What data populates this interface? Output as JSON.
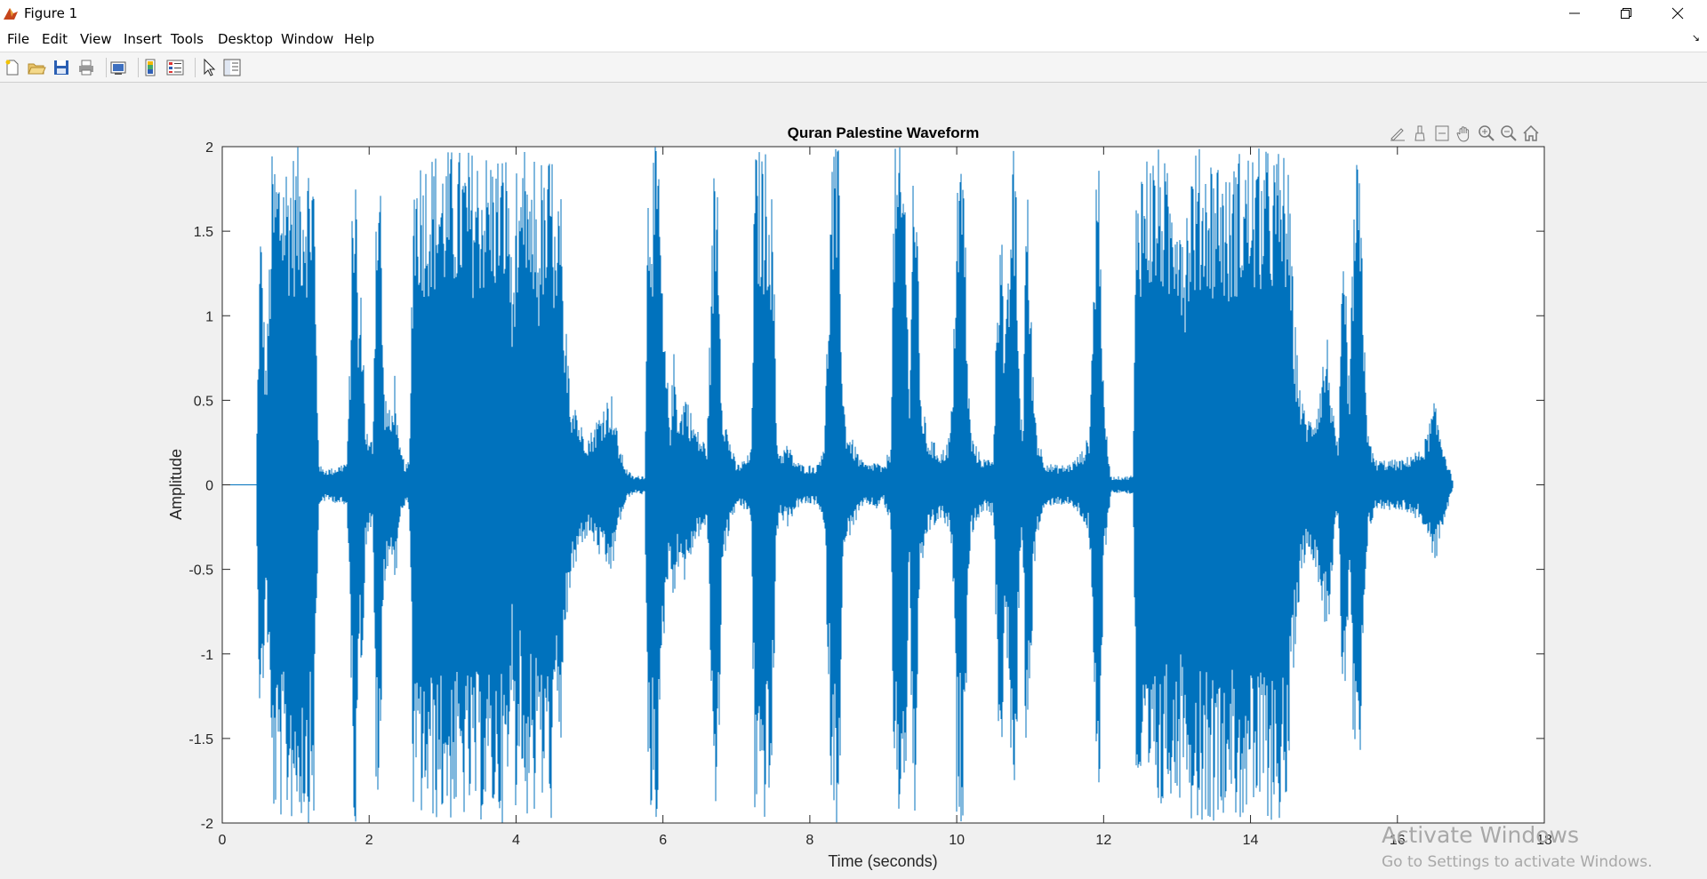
{
  "window": {
    "title": "Figure 1",
    "controls": {
      "minimize": "minimize-icon",
      "restore": "restore-icon",
      "close": "close-icon"
    }
  },
  "menu": {
    "items": [
      {
        "label": "File"
      },
      {
        "label": "Edit"
      },
      {
        "label": "View"
      },
      {
        "label": "Insert"
      },
      {
        "label": "Tools"
      },
      {
        "label": "Desktop"
      },
      {
        "label": "Window"
      },
      {
        "label": "Help"
      }
    ],
    "corner": "↘"
  },
  "toolbar": {
    "buttons": [
      "new-figure-icon",
      "open-file-icon",
      "save-icon",
      "print-icon",
      "link-plot-icon",
      "colorbar-icon",
      "legend-icon",
      "edit-plot-icon",
      "property-inspector-icon"
    ]
  },
  "axes_toolbar": {
    "buttons": [
      "brush-edit-icon",
      "brush-icon",
      "data-tips-icon",
      "pan-icon",
      "zoom-in-icon",
      "zoom-out-icon",
      "home-icon"
    ]
  },
  "watermark": {
    "line1": "Activate Windows",
    "line2": "Go to Settings to activate Windows."
  },
  "colors": {
    "series": "#0072BD",
    "axes": "#262626",
    "background": "#f0f0f0"
  },
  "chart_data": {
    "type": "line",
    "title": "Quran Palestine Waveform",
    "xlabel": "Time (seconds)",
    "ylabel": "Amplitude",
    "xlim": [
      0,
      18
    ],
    "ylim": [
      -2,
      2
    ],
    "xticks": [
      0,
      2,
      4,
      6,
      8,
      10,
      12,
      14,
      16,
      18
    ],
    "yticks": [
      -2,
      -1.5,
      -1,
      -0.5,
      0,
      0.5,
      1,
      1.5,
      2
    ],
    "ytick_labels": [
      "-2",
      "-1.5",
      "-1",
      "-0.5",
      "0",
      "0.5",
      "1",
      "1.5",
      "2"
    ],
    "grid": false,
    "signal_range": [
      0.47,
      16.75
    ],
    "series": [
      {
        "envelope": {
          "t": [
            0,
            0.46,
            0.5,
            0.52,
            0.55,
            0.57,
            0.6,
            0.63,
            0.68,
            0.7,
            0.72,
            0.8,
            1.0,
            1.15,
            1.2,
            1.25,
            1.27,
            1.3,
            1.32,
            1.35,
            1.5,
            1.6,
            1.7,
            1.75,
            1.78,
            1.82,
            1.85,
            1.9,
            1.95,
            2.0,
            2.05,
            2.1,
            2.15,
            2.2,
            2.25,
            2.3,
            2.35,
            2.4,
            2.5,
            2.55,
            2.6,
            3.0,
            3.5,
            3.7,
            3.75,
            3.8,
            3.85,
            3.9,
            3.95,
            4.0,
            4.05,
            4.1,
            4.15,
            4.2,
            4.25,
            4.3,
            4.35,
            4.4,
            4.45,
            4.5,
            4.55,
            4.6,
            4.65,
            4.7,
            4.75,
            4.8,
            4.85,
            4.9,
            5.0,
            5.1,
            5.2,
            5.3,
            5.4,
            5.5,
            5.6,
            5.75,
            5.8,
            5.85,
            5.9,
            5.95,
            6.0,
            6.05,
            6.1,
            6.15,
            6.2,
            6.25,
            6.3,
            6.4,
            6.5,
            6.6,
            6.7,
            6.75,
            6.8,
            6.85,
            6.9,
            7.0,
            7.1,
            7.2,
            7.25,
            7.3,
            7.35,
            7.4,
            7.45,
            7.5,
            7.55,
            7.6,
            7.7,
            7.8,
            7.9,
            8.0,
            8.1,
            8.2,
            8.3,
            8.35,
            8.4,
            8.45,
            8.5,
            8.6,
            8.7,
            8.8,
            8.9,
            9.0,
            9.1,
            9.15,
            9.2,
            9.25,
            9.3,
            9.35,
            9.4,
            9.45,
            9.5,
            9.6,
            9.7,
            9.8,
            9.9,
            9.95,
            10.0,
            10.05,
            10.1,
            10.15,
            10.2,
            10.3,
            10.4,
            10.5,
            10.55,
            10.6,
            10.65,
            10.7,
            10.75,
            10.8,
            10.85,
            10.9,
            10.95,
            11.0,
            11.05,
            11.1,
            11.2,
            11.3,
            11.4,
            11.5,
            11.6,
            11.7,
            11.8,
            11.85,
            11.9,
            11.95,
            12.0,
            12.1,
            12.2,
            12.3,
            12.4,
            12.45,
            12.5,
            12.6,
            12.7,
            12.8,
            12.9,
            13.0,
            13.1,
            13.2,
            13.25,
            13.3,
            13.35,
            13.4,
            13.45,
            13.5,
            13.6,
            13.7,
            13.8,
            13.85,
            13.9,
            14.0,
            14.1,
            14.2,
            14.3,
            14.4,
            14.45,
            14.5,
            14.55,
            14.6,
            14.7,
            14.8,
            14.9,
            15.0,
            15.05,
            15.1,
            15.15,
            15.2,
            15.25,
            15.3,
            15.35,
            15.4,
            15.45,
            15.5,
            15.6,
            15.7,
            15.8,
            15.9,
            16.0,
            16.1,
            16.2,
            16.3,
            16.4,
            16.5,
            16.6,
            16.7,
            16.75,
            18
          ],
          "amp": [
            0,
            0,
            1.2,
            1.6,
            1.4,
            1.0,
            0.7,
            1.2,
            2.0,
            2.0,
            2.0,
            2.0,
            2.0,
            2.0,
            2.0,
            2.0,
            1.2,
            0.5,
            0.15,
            0.1,
            0.1,
            0.12,
            0.15,
            1.0,
            2.0,
            2.0,
            1.0,
            1.2,
            0.4,
            0.25,
            0.3,
            2.0,
            2.0,
            0.6,
            0.5,
            0.4,
            0.7,
            0.25,
            0.12,
            0.15,
            2.0,
            2.0,
            2.0,
            2.0,
            2.0,
            2.0,
            2.0,
            2.0,
            1.1,
            2.0,
            1.5,
            2.0,
            2.0,
            1.6,
            2.0,
            1.5,
            2.0,
            1.7,
            2.0,
            2.0,
            1.3,
            2.0,
            0.8,
            1.0,
            0.5,
            0.6,
            0.4,
            0.35,
            0.3,
            0.4,
            0.5,
            0.55,
            0.25,
            0.1,
            0.05,
            0.06,
            2.0,
            2.0,
            2.0,
            2.0,
            1.0,
            0.7,
            0.4,
            0.8,
            0.5,
            0.45,
            0.6,
            0.4,
            0.3,
            0.25,
            2.0,
            2.0,
            0.6,
            0.4,
            0.3,
            0.12,
            0.15,
            0.2,
            2.0,
            2.0,
            2.0,
            2.0,
            2.0,
            1.6,
            0.3,
            0.2,
            0.25,
            0.15,
            0.12,
            0.12,
            0.12,
            0.3,
            2.0,
            2.0,
            2.0,
            0.6,
            0.35,
            0.25,
            0.15,
            0.12,
            0.15,
            0.1,
            0.25,
            2.0,
            2.0,
            2.0,
            2.0,
            0.5,
            2.0,
            2.0,
            0.6,
            0.3,
            0.25,
            0.2,
            0.3,
            0.6,
            2.0,
            2.0,
            2.0,
            0.7,
            0.3,
            0.2,
            0.15,
            0.2,
            1.2,
            2.0,
            0.8,
            1.2,
            2.0,
            2.0,
            0.7,
            0.3,
            2.0,
            1.2,
            0.6,
            0.3,
            0.15,
            0.12,
            0.12,
            0.12,
            0.15,
            0.2,
            0.3,
            1.0,
            2.0,
            2.0,
            0.5,
            0.05,
            0.05,
            0.05,
            0.06,
            2.0,
            2.0,
            2.0,
            2.0,
            2.0,
            1.8,
            2.0,
            1.6,
            2.0,
            2.0,
            2.0,
            2.0,
            2.0,
            2.0,
            2.0,
            2.0,
            1.8,
            2.0,
            2.0,
            2.0,
            2.0,
            2.0,
            2.0,
            2.0,
            2.0,
            2.0,
            2.0,
            1.5,
            1.0,
            0.5,
            0.4,
            0.5,
            0.8,
            0.9,
            0.6,
            0.3,
            0.25,
            1.3,
            1.2,
            0.5,
            1.7,
            2.0,
            1.7,
            0.3,
            0.15,
            0.15,
            0.15,
            0.15,
            0.15,
            0.2,
            0.2,
            0.3,
            0.5,
            0.3,
            0.12,
            0.03,
            0.01,
            0
          ]
        }
      }
    ]
  }
}
